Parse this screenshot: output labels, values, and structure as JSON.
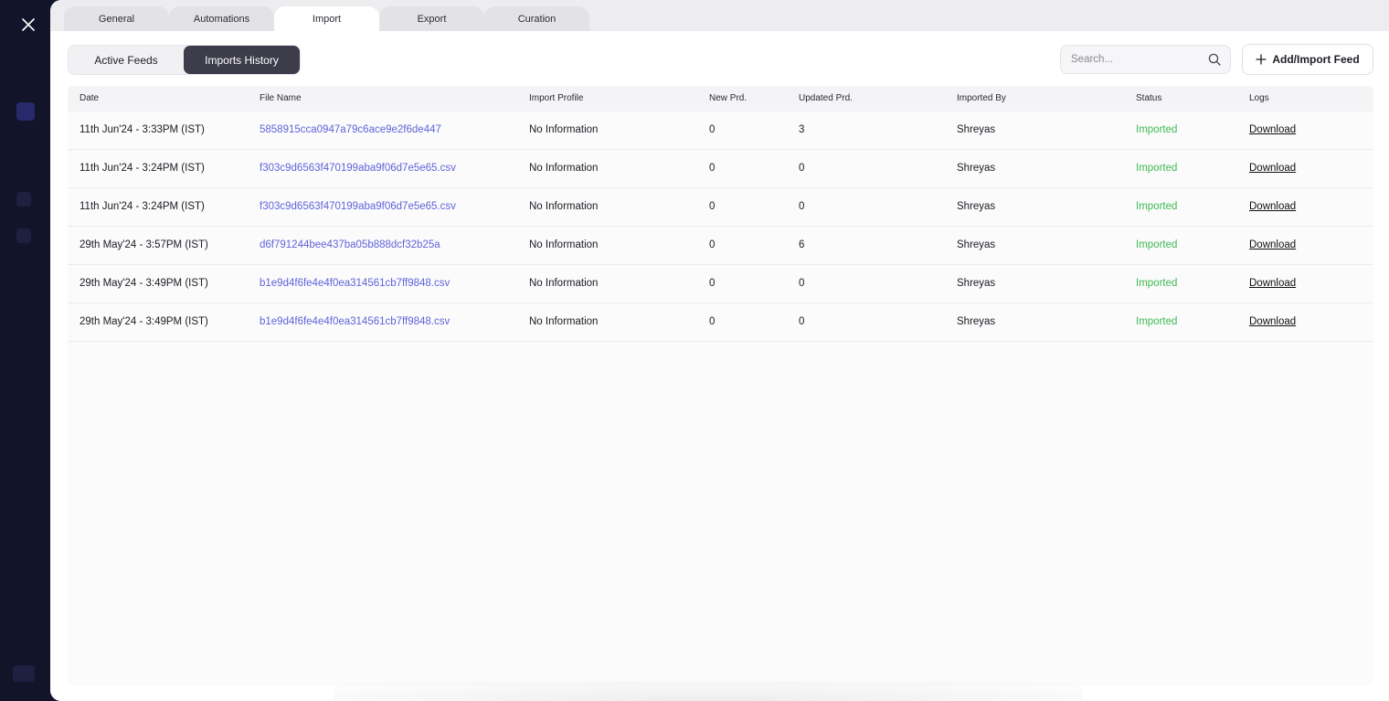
{
  "colors": {
    "accent_link": "#5f63d9",
    "status_ok": "#3fb950",
    "segment_active": "#3c3c4a",
    "backdrop": "#12142a"
  },
  "close_icon": "close-icon",
  "tabs": [
    {
      "label": "General",
      "active": false
    },
    {
      "label": "Automations",
      "active": false
    },
    {
      "label": "Import",
      "active": true
    },
    {
      "label": "Export",
      "active": false
    },
    {
      "label": "Curation",
      "active": false
    }
  ],
  "segments": {
    "active_feeds": "Active Feeds",
    "imports_history": "Imports History",
    "selected": "Imports History"
  },
  "search": {
    "placeholder": "Search...",
    "value": "",
    "icon": "search-icon"
  },
  "add_button": {
    "label": "Add/Import Feed",
    "icon": "plus-icon"
  },
  "table": {
    "columns": [
      "Date",
      "File Name",
      "Import Profile",
      "New Prd.",
      "Updated Prd.",
      "Imported By",
      "Status",
      "Logs"
    ],
    "rows": [
      {
        "date": "11th Jun'24 - 3:33PM (IST)",
        "file": "5858915cca0947a79c6ace9e2f6de447",
        "profile": "No Information",
        "new": "0",
        "updated": "3",
        "by": "Shreyas",
        "status": "Imported",
        "logs": "Download"
      },
      {
        "date": "11th Jun'24 - 3:24PM (IST)",
        "file": "f303c9d6563f470199aba9f06d7e5e65.csv",
        "profile": "No Information",
        "new": "0",
        "updated": "0",
        "by": "Shreyas",
        "status": "Imported",
        "logs": "Download"
      },
      {
        "date": "11th Jun'24 - 3:24PM (IST)",
        "file": "f303c9d6563f470199aba9f06d7e5e65.csv",
        "profile": "No Information",
        "new": "0",
        "updated": "0",
        "by": "Shreyas",
        "status": "Imported",
        "logs": "Download"
      },
      {
        "date": "29th May'24 - 3:57PM (IST)",
        "file": "d6f791244bee437ba05b888dcf32b25a",
        "profile": "No Information",
        "new": "0",
        "updated": "6",
        "by": "Shreyas",
        "status": "Imported",
        "logs": "Download"
      },
      {
        "date": "29th May'24 - 3:49PM (IST)",
        "file": "b1e9d4f6fe4e4f0ea314561cb7ff9848.csv",
        "profile": "No Information",
        "new": "0",
        "updated": "0",
        "by": "Shreyas",
        "status": "Imported",
        "logs": "Download"
      },
      {
        "date": "29th May'24 - 3:49PM (IST)",
        "file": "b1e9d4f6fe4e4f0ea314561cb7ff9848.csv",
        "profile": "No Information",
        "new": "0",
        "updated": "0",
        "by": "Shreyas",
        "status": "Imported",
        "logs": "Download"
      }
    ]
  }
}
